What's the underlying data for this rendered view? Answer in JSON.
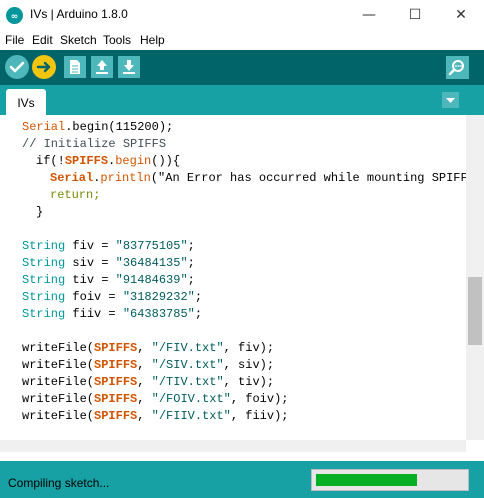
{
  "window": {
    "title": "IVs | Arduino 1.8.0",
    "minimize_glyph": "—",
    "maximize_glyph": "☐",
    "close_glyph": "✕"
  },
  "menu": [
    "File",
    "Edit",
    "Sketch",
    "Tools",
    "Help"
  ],
  "toolbar": {
    "verify_icon": "checkmark-icon",
    "upload_icon": "arrow-right-icon",
    "new_icon": "new-file-icon",
    "open_icon": "open-upload-icon",
    "save_icon": "save-download-icon",
    "serial_monitor_icon": "magnifier-icon"
  },
  "tabs": [
    {
      "label": "IVs"
    }
  ],
  "code": {
    "line1": [
      "Serial",
      ".begin(115200);"
    ],
    "line2": "// Initialize SPIFFS",
    "line3": [
      "if(!",
      "SPIFFS",
      ".",
      "begin",
      "()){"
    ],
    "line4": [
      "Serial",
      ".",
      "println",
      "(\"An Error has occurred while mounting SPIFFS\""
    ],
    "line5": "return;",
    "line6": "}",
    "line7": [
      "String",
      " fiv = ",
      "\"83775105\"",
      ";"
    ],
    "line8": [
      "String",
      " siv = ",
      "\"36484135\"",
      ";"
    ],
    "line9": [
      "String",
      " tiv = ",
      "\"91484639\"",
      ";"
    ],
    "line10": [
      "String",
      " foiv = ",
      "\"31829232\"",
      ";"
    ],
    "line11": [
      "String",
      " fiiv = ",
      "\"64383785\"",
      ";"
    ],
    "line12": [
      "writeFile(",
      "SPIFFS",
      ", ",
      "\"/FIV.txt\"",
      ", fiv);"
    ],
    "line13": [
      "writeFile(",
      "SPIFFS",
      ", ",
      "\"/SIV.txt\"",
      ", siv);"
    ],
    "line14": [
      "writeFile(",
      "SPIFFS",
      ", ",
      "\"/TIV.txt\"",
      ", tiv);"
    ],
    "line15": [
      "writeFile(",
      "SPIFFS",
      ", ",
      "\"/FOIV.txt\"",
      ", foiv);"
    ],
    "line16": [
      "writeFile(",
      "SPIFFS",
      ", ",
      "\"/FIIV.txt\"",
      ", fiiv);"
    ]
  },
  "status": {
    "text": "Compiling sketch...",
    "progress": 0.68
  },
  "colors": {
    "toolbar_bg": "#006468",
    "tab_bg": "#17a1a5",
    "verify": "#4db7bb",
    "upload": "#f1c40f",
    "progress_fill": "#06b025"
  }
}
